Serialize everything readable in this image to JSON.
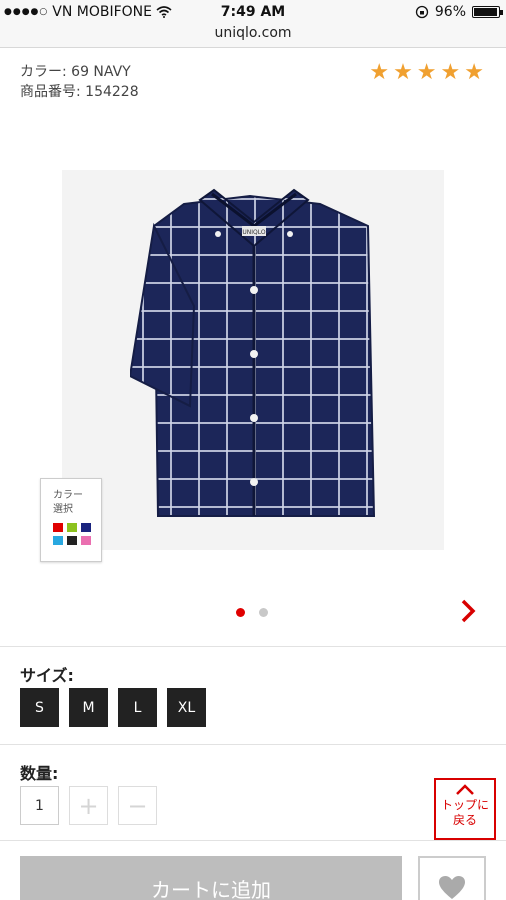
{
  "status_bar": {
    "carrier": "VN MOBIFONE",
    "time": "7:49 AM",
    "battery": "96%",
    "battery_level": 0.96,
    "url": "uniqlo.com"
  },
  "product": {
    "color_line": "カラー: 69 NAVY",
    "number_line": "商品番号: 154228",
    "rating_stars": 5,
    "image_label": "navy-windowpane-short-sleeve-shirt",
    "shirt_tag": "UNIQLO"
  },
  "swatch_panel": {
    "label_line1": "カラー",
    "label_line2": "選択",
    "colors": [
      "#e00000",
      "#8cc21e",
      "#1a237e",
      "#29a8e0",
      "#222222",
      "#ea6fb0"
    ]
  },
  "carousel": {
    "page_count": 2,
    "active_index": 0
  },
  "size_section": {
    "label": "サイズ:",
    "options": [
      "S",
      "M",
      "L",
      "XL"
    ]
  },
  "quantity_section": {
    "label": "数量:",
    "value": "1",
    "plus": "+",
    "minus": "−"
  },
  "back_to_top": {
    "line1": "トップに",
    "line2": "戻る"
  },
  "actions": {
    "add_to_cart": "カートに追加"
  },
  "colors": {
    "accent": "#d80000",
    "star": "#f0a030",
    "cart_disabled": "#bdbdbd"
  }
}
